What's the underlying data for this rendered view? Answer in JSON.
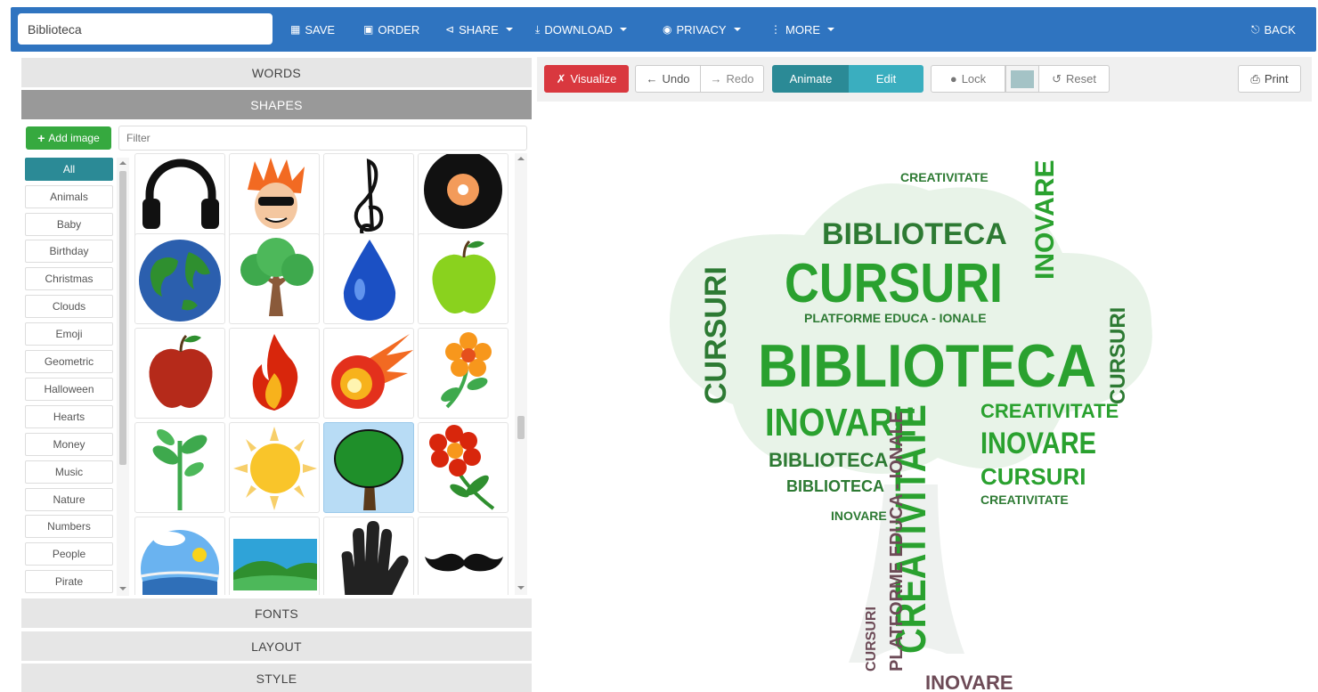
{
  "toolbar": {
    "title_value": "Biblioteca",
    "save": "SAVE",
    "order": "ORDER",
    "share": "SHARE",
    "download": "DOWNLOAD",
    "privacy": "PRIVACY",
    "more": "MORE",
    "back": "BACK"
  },
  "sections": {
    "words": "WORDS",
    "shapes": "SHAPES",
    "fonts": "FONTS",
    "layout": "LAYOUT",
    "style": "STYLE"
  },
  "shapes_panel": {
    "add_image": "Add image",
    "filter_placeholder": "Filter",
    "categories": [
      "All",
      "Animals",
      "Baby",
      "Birthday",
      "Christmas",
      "Clouds",
      "Emoji",
      "Geometric",
      "Halloween",
      "Hearts",
      "Money",
      "Music",
      "Nature",
      "Numbers",
      "People",
      "Pirate"
    ],
    "selected_category": "All",
    "shape_icons": [
      "headphones-icon",
      "cartoon-face-icon",
      "treble-clef-icon",
      "vinyl-record-icon",
      "earth-globe-icon",
      "tree-icon",
      "water-drop-icon",
      "green-apple-icon",
      "red-apple-icon",
      "fire-icon",
      "fireball-icon",
      "flower-icon",
      "sprout-icon",
      "sun-icon",
      "tree-icon",
      "red-flower-icon",
      "sky-landscape-icon",
      "hills-landscape-icon",
      "hand-icon",
      "mustache-icon"
    ],
    "selected_shape": "tree-icon"
  },
  "editor": {
    "visualize": "Visualize",
    "undo": "Undo",
    "redo": "Redo",
    "animate": "Animate",
    "edit": "Edit",
    "lock": "Lock",
    "reset": "Reset",
    "print": "Print",
    "swatch_color": "#a4c3c6"
  },
  "wordcloud": {
    "shape": "tree",
    "words": [
      "CURSURI",
      "BIBLIOTECA",
      "INOVARE",
      "CREATIVITATE",
      "PLATFORME EDUCA - IONALE"
    ],
    "colors": [
      "#2aa12f",
      "#2d7a33",
      "#6d4b57"
    ]
  }
}
